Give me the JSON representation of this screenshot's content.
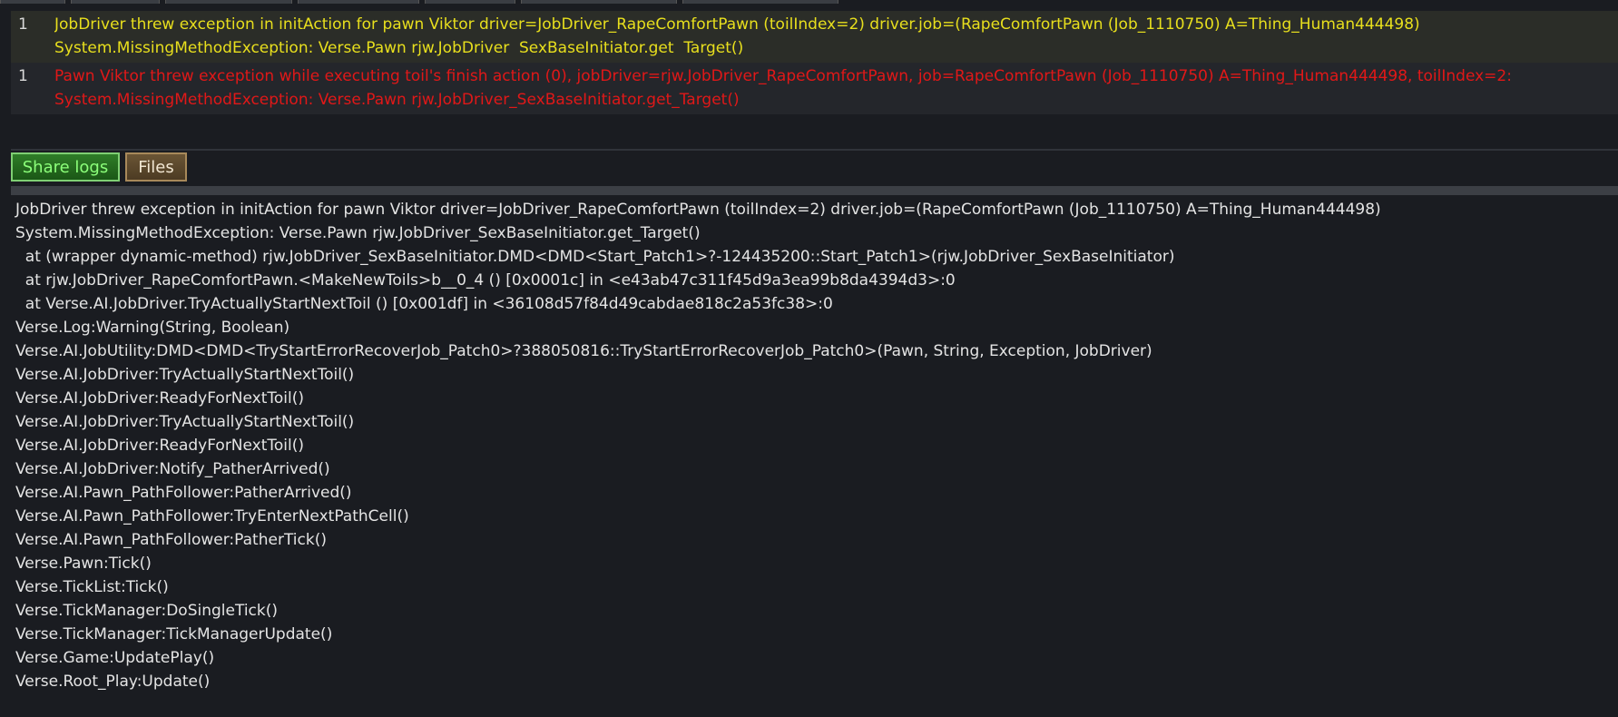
{
  "entries": [
    {
      "count": "1",
      "line1": "JobDriver threw exception in initAction for pawn Viktor driver=JobDriver_RapeComfortPawn (toilIndex=2) driver.job=(RapeComfortPawn (Job_1110750) A=Thing_Human444498)",
      "line2": "System.MissingMethodException: Verse.Pawn rjw.JobDriver  SexBaseInitiator.get  Target()",
      "color": "#e8df1d"
    },
    {
      "count": "1",
      "line1": "Pawn Viktor threw exception while executing toil's finish action (0), jobDriver=rjw.JobDriver_RapeComfortPawn, job=RapeComfortPawn (Job_1110750) A=Thing_Human444498, toilIndex=2:",
      "line2": "System.MissingMethodException: Verse.Pawn rjw.JobDriver_SexBaseInitiator.get_Target()",
      "color": "#e01818"
    }
  ],
  "buttons": {
    "share_label": "Share logs",
    "files_label": "Files"
  },
  "detail_lines": [
    "JobDriver threw exception in initAction for pawn Viktor driver=JobDriver_RapeComfortPawn (toilIndex=2) driver.job=(RapeComfortPawn (Job_1110750) A=Thing_Human444498)",
    "System.MissingMethodException: Verse.Pawn rjw.JobDriver_SexBaseInitiator.get_Target()",
    "  at (wrapper dynamic-method) rjw.JobDriver_SexBaseInitiator.DMD<DMD<Start_Patch1>?-124435200::Start_Patch1>(rjw.JobDriver_SexBaseInitiator)",
    "  at rjw.JobDriver_RapeComfortPawn.<MakeNewToils>b__0_4 () [0x0001c] in <e43ab47c311f45d9a3ea99b8da4394d3>:0",
    "  at Verse.AI.JobDriver.TryActuallyStartNextToil () [0x001df] in <36108d57f84d49cabdae818c2a53fc38>:0",
    "Verse.Log:Warning(String, Boolean)",
    "Verse.AI.JobUtility:DMD<DMD<TryStartErrorRecoverJob_Patch0>?388050816::TryStartErrorRecoverJob_Patch0>(Pawn, String, Exception, JobDriver)",
    "Verse.AI.JobDriver:TryActuallyStartNextToil()",
    "Verse.AI.JobDriver:ReadyForNextToil()",
    "Verse.AI.JobDriver:TryActuallyStartNextToil()",
    "Verse.AI.JobDriver:ReadyForNextToil()",
    "Verse.AI.JobDriver:Notify_PatherArrived()",
    "Verse.AI.Pawn_PathFollower:PatherArrived()",
    "Verse.AI.Pawn_PathFollower:TryEnterNextPathCell()",
    "Verse.AI.Pawn_PathFollower:PatherTick()",
    "Verse.Pawn:Tick()",
    "Verse.TickList:Tick()",
    "Verse.TickManager:DoSingleTick()",
    "Verse.TickManager:TickManagerUpdate()",
    "Verse.Game:UpdatePlay()",
    "Verse.Root_Play:Update()"
  ]
}
